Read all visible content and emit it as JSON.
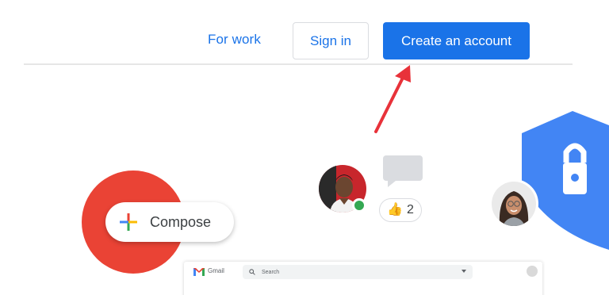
{
  "header": {
    "for_work_label": "For work",
    "sign_in_label": "Sign in",
    "create_account_label": "Create an account"
  },
  "illustration": {
    "compose_label": "Compose",
    "reaction_emoji": "👍",
    "reaction_count": "2"
  },
  "gmail_preview": {
    "app_name": "Gmail",
    "search_placeholder": "Search"
  },
  "colors": {
    "accent_blue": "#1a73e8",
    "google_red": "#ea4335",
    "google_green": "#34a853",
    "google_yellow": "#fbbc04",
    "shield_blue": "#4285f4",
    "annotation_red": "#e8323a"
  },
  "icons": [
    "annotation-arrow-icon",
    "compose-plus-icon",
    "thumbs-up-icon",
    "shield-lock-icon",
    "gmail-logo-icon",
    "search-icon",
    "chevron-down-icon",
    "chat-bubble-icon"
  ]
}
